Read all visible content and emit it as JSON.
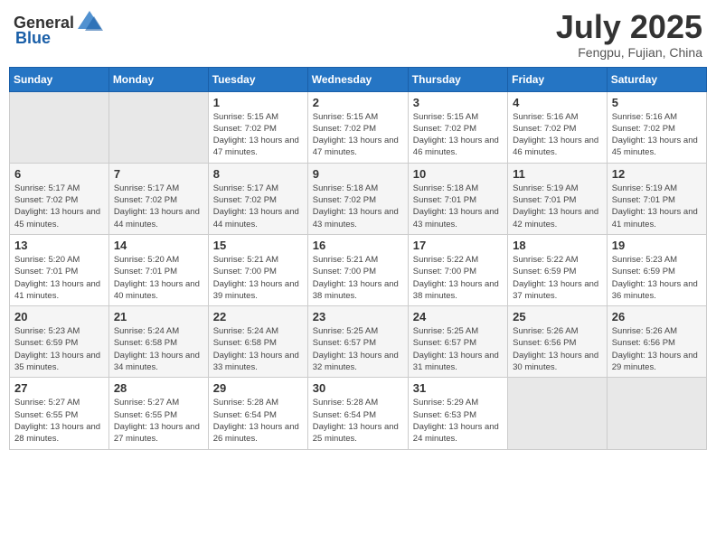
{
  "header": {
    "logo_general": "General",
    "logo_blue": "Blue",
    "month_title": "July 2025",
    "location": "Fengpu, Fujian, China"
  },
  "weekdays": [
    "Sunday",
    "Monday",
    "Tuesday",
    "Wednesday",
    "Thursday",
    "Friday",
    "Saturday"
  ],
  "weeks": [
    [
      {
        "day": "",
        "info": ""
      },
      {
        "day": "",
        "info": ""
      },
      {
        "day": "1",
        "info": "Sunrise: 5:15 AM\nSunset: 7:02 PM\nDaylight: 13 hours and 47 minutes."
      },
      {
        "day": "2",
        "info": "Sunrise: 5:15 AM\nSunset: 7:02 PM\nDaylight: 13 hours and 47 minutes."
      },
      {
        "day": "3",
        "info": "Sunrise: 5:15 AM\nSunset: 7:02 PM\nDaylight: 13 hours and 46 minutes."
      },
      {
        "day": "4",
        "info": "Sunrise: 5:16 AM\nSunset: 7:02 PM\nDaylight: 13 hours and 46 minutes."
      },
      {
        "day": "5",
        "info": "Sunrise: 5:16 AM\nSunset: 7:02 PM\nDaylight: 13 hours and 45 minutes."
      }
    ],
    [
      {
        "day": "6",
        "info": "Sunrise: 5:17 AM\nSunset: 7:02 PM\nDaylight: 13 hours and 45 minutes."
      },
      {
        "day": "7",
        "info": "Sunrise: 5:17 AM\nSunset: 7:02 PM\nDaylight: 13 hours and 44 minutes."
      },
      {
        "day": "8",
        "info": "Sunrise: 5:17 AM\nSunset: 7:02 PM\nDaylight: 13 hours and 44 minutes."
      },
      {
        "day": "9",
        "info": "Sunrise: 5:18 AM\nSunset: 7:02 PM\nDaylight: 13 hours and 43 minutes."
      },
      {
        "day": "10",
        "info": "Sunrise: 5:18 AM\nSunset: 7:01 PM\nDaylight: 13 hours and 43 minutes."
      },
      {
        "day": "11",
        "info": "Sunrise: 5:19 AM\nSunset: 7:01 PM\nDaylight: 13 hours and 42 minutes."
      },
      {
        "day": "12",
        "info": "Sunrise: 5:19 AM\nSunset: 7:01 PM\nDaylight: 13 hours and 41 minutes."
      }
    ],
    [
      {
        "day": "13",
        "info": "Sunrise: 5:20 AM\nSunset: 7:01 PM\nDaylight: 13 hours and 41 minutes."
      },
      {
        "day": "14",
        "info": "Sunrise: 5:20 AM\nSunset: 7:01 PM\nDaylight: 13 hours and 40 minutes."
      },
      {
        "day": "15",
        "info": "Sunrise: 5:21 AM\nSunset: 7:00 PM\nDaylight: 13 hours and 39 minutes."
      },
      {
        "day": "16",
        "info": "Sunrise: 5:21 AM\nSunset: 7:00 PM\nDaylight: 13 hours and 38 minutes."
      },
      {
        "day": "17",
        "info": "Sunrise: 5:22 AM\nSunset: 7:00 PM\nDaylight: 13 hours and 38 minutes."
      },
      {
        "day": "18",
        "info": "Sunrise: 5:22 AM\nSunset: 6:59 PM\nDaylight: 13 hours and 37 minutes."
      },
      {
        "day": "19",
        "info": "Sunrise: 5:23 AM\nSunset: 6:59 PM\nDaylight: 13 hours and 36 minutes."
      }
    ],
    [
      {
        "day": "20",
        "info": "Sunrise: 5:23 AM\nSunset: 6:59 PM\nDaylight: 13 hours and 35 minutes."
      },
      {
        "day": "21",
        "info": "Sunrise: 5:24 AM\nSunset: 6:58 PM\nDaylight: 13 hours and 34 minutes."
      },
      {
        "day": "22",
        "info": "Sunrise: 5:24 AM\nSunset: 6:58 PM\nDaylight: 13 hours and 33 minutes."
      },
      {
        "day": "23",
        "info": "Sunrise: 5:25 AM\nSunset: 6:57 PM\nDaylight: 13 hours and 32 minutes."
      },
      {
        "day": "24",
        "info": "Sunrise: 5:25 AM\nSunset: 6:57 PM\nDaylight: 13 hours and 31 minutes."
      },
      {
        "day": "25",
        "info": "Sunrise: 5:26 AM\nSunset: 6:56 PM\nDaylight: 13 hours and 30 minutes."
      },
      {
        "day": "26",
        "info": "Sunrise: 5:26 AM\nSunset: 6:56 PM\nDaylight: 13 hours and 29 minutes."
      }
    ],
    [
      {
        "day": "27",
        "info": "Sunrise: 5:27 AM\nSunset: 6:55 PM\nDaylight: 13 hours and 28 minutes."
      },
      {
        "day": "28",
        "info": "Sunrise: 5:27 AM\nSunset: 6:55 PM\nDaylight: 13 hours and 27 minutes."
      },
      {
        "day": "29",
        "info": "Sunrise: 5:28 AM\nSunset: 6:54 PM\nDaylight: 13 hours and 26 minutes."
      },
      {
        "day": "30",
        "info": "Sunrise: 5:28 AM\nSunset: 6:54 PM\nDaylight: 13 hours and 25 minutes."
      },
      {
        "day": "31",
        "info": "Sunrise: 5:29 AM\nSunset: 6:53 PM\nDaylight: 13 hours and 24 minutes."
      },
      {
        "day": "",
        "info": ""
      },
      {
        "day": "",
        "info": ""
      }
    ]
  ]
}
